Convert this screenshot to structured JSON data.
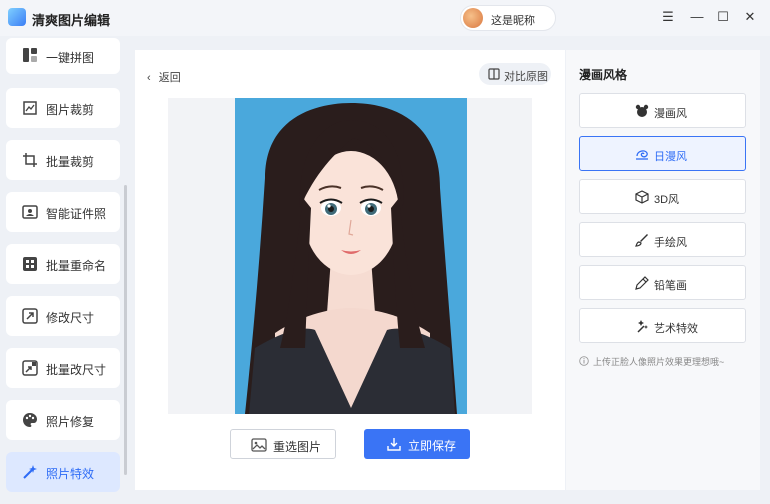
{
  "app": {
    "title": "清爽图片编辑",
    "user_nickname": "这是昵称"
  },
  "window_controls": {
    "menu": "☰",
    "minimize": "—",
    "maximize": "☐",
    "close": "✕"
  },
  "sidebar": {
    "items": [
      {
        "label": "一键拼图",
        "icon": "collage-icon"
      },
      {
        "label": "图片裁剪",
        "icon": "crop-icon"
      },
      {
        "label": "批量裁剪",
        "icon": "batch-crop-icon"
      },
      {
        "label": "智能证件照",
        "icon": "id-photo-icon"
      },
      {
        "label": "批量重命名",
        "icon": "rename-icon"
      },
      {
        "label": "修改尺寸",
        "icon": "resize-icon"
      },
      {
        "label": "批量改尺寸",
        "icon": "batch-resize-icon"
      },
      {
        "label": "照片修复",
        "icon": "palette-icon"
      },
      {
        "label": "照片特效",
        "icon": "magic-wand-icon",
        "active": true
      }
    ]
  },
  "editor": {
    "back_label": "返回",
    "compare_label": "对比原图",
    "reselect_label": "重选图片",
    "save_label": "立即保存"
  },
  "styles_panel": {
    "title": "漫画风格",
    "items": [
      {
        "label": "漫画风",
        "icon": "bear-icon"
      },
      {
        "label": "日漫风",
        "icon": "swirl-icon",
        "active": true
      },
      {
        "label": "3D风",
        "icon": "cube-icon"
      },
      {
        "label": "手绘风",
        "icon": "brush-icon"
      },
      {
        "label": "铅笔画",
        "icon": "pencil-icon"
      },
      {
        "label": "艺术特效",
        "icon": "sparkle-wand-icon"
      }
    ],
    "hint": "上传正脸人像照片效果更理想哦~"
  },
  "colors": {
    "accent": "#3a74f5",
    "active_bg": "#dde8ff",
    "photo_bg": "#4aa8dc"
  }
}
